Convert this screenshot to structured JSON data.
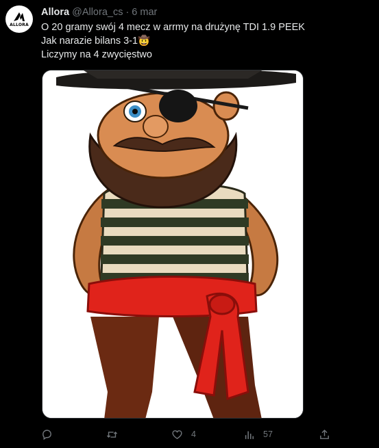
{
  "tweet": {
    "author": {
      "name": "Allora",
      "handle": "@Allora_cs",
      "separator": "·",
      "date": "6 mar",
      "avatar_text": "ALLORA"
    },
    "text_lines": [
      "O 20 gramy swój 4 mecz w arrmy na drużynę TDI 1.9 PEEK",
      "Jak narazie bilans 3-1🤠",
      "Liczymy na 4 zwycięstwo"
    ],
    "media": {
      "description_icon": "cartoon-pirate-image"
    },
    "actions": {
      "reply": {
        "icon": "reply-icon",
        "count": ""
      },
      "retweet": {
        "icon": "retweet-icon",
        "count": ""
      },
      "like": {
        "icon": "heart-icon",
        "count": "4"
      },
      "views": {
        "icon": "views-icon",
        "count": "57"
      },
      "share": {
        "icon": "share-icon",
        "count": ""
      }
    }
  },
  "colors": {
    "background": "#000000",
    "text": "#e7e9ea",
    "secondary": "#71767b"
  }
}
